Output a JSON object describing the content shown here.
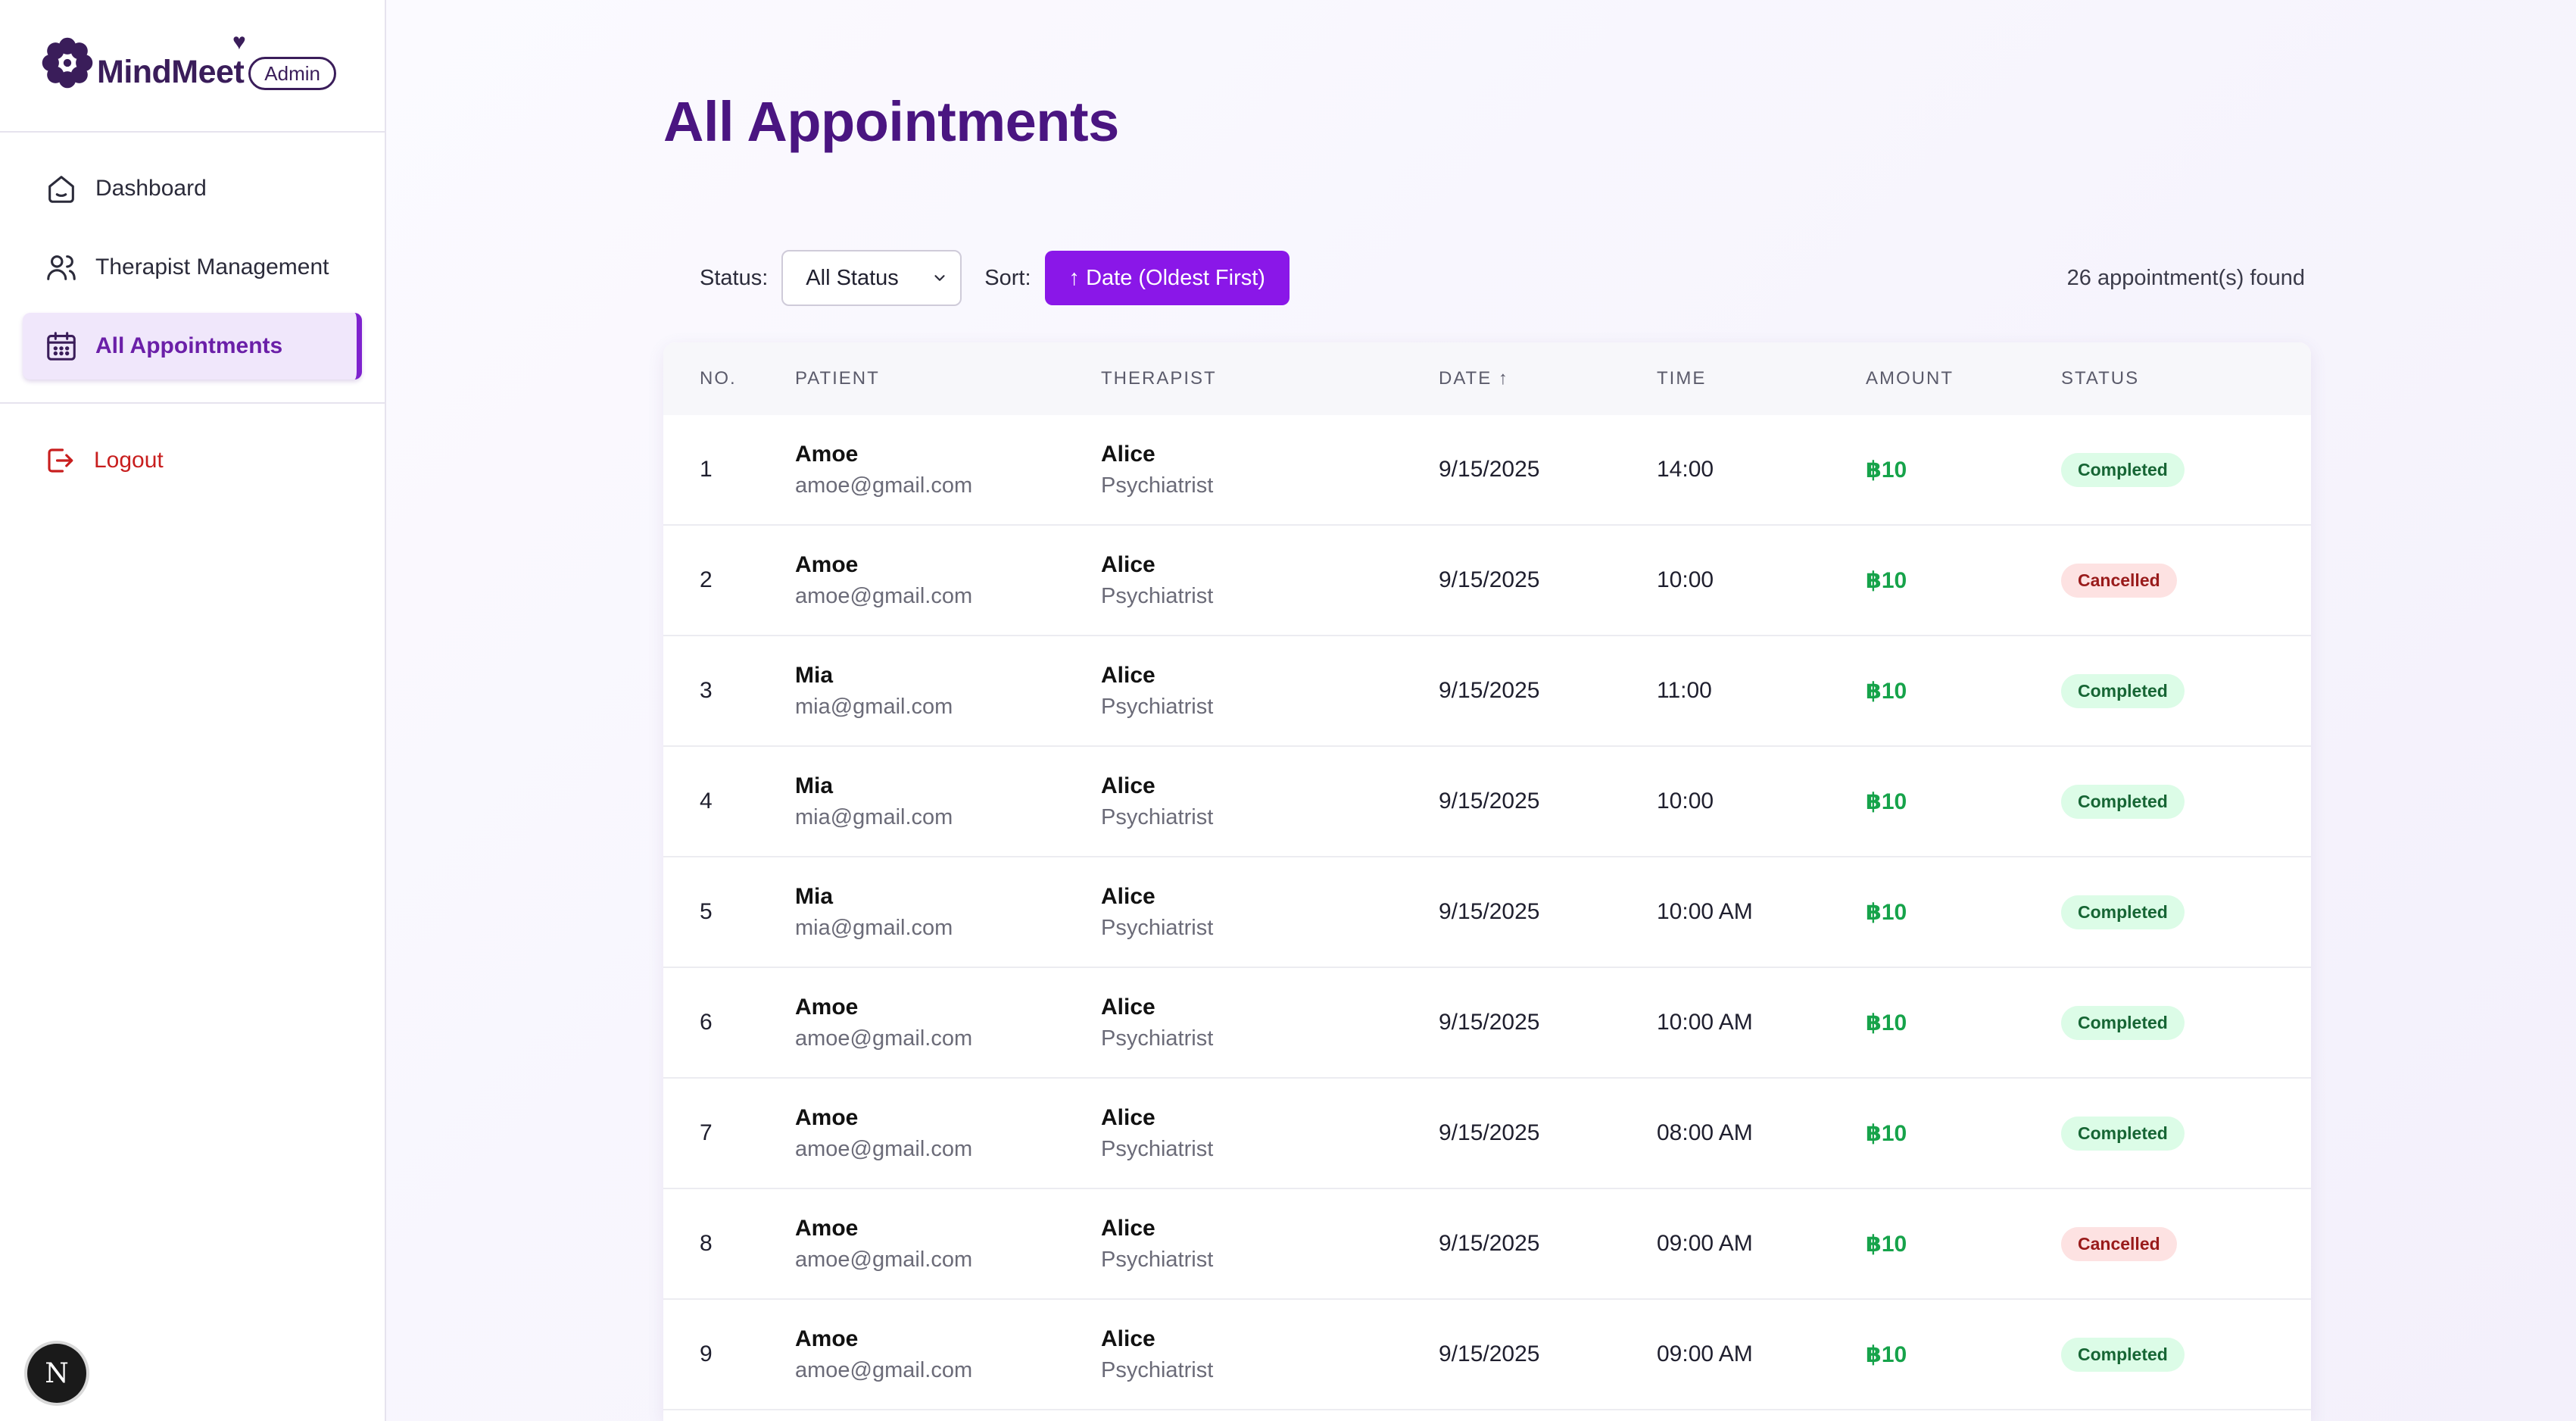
{
  "brand": {
    "name": "MindMeet",
    "badge": "Admin"
  },
  "sidebar": {
    "items": [
      {
        "label": "Dashboard",
        "icon": "home-icon"
      },
      {
        "label": "Therapist Management",
        "icon": "users-icon"
      },
      {
        "label": "All Appointments",
        "icon": "calendar-icon",
        "active": true
      }
    ],
    "logout_label": "Logout"
  },
  "page": {
    "title": "All Appointments"
  },
  "filters": {
    "status_label": "Status:",
    "status_value": "All Status",
    "sort_label": "Sort:",
    "sort_button": "↑ Date (Oldest First)",
    "count_text": "26 appointment(s) found"
  },
  "table": {
    "columns": [
      "NO.",
      "PATIENT",
      "THERAPIST",
      "DATE ↑",
      "TIME",
      "AMOUNT",
      "STATUS"
    ],
    "rows": [
      {
        "no": "1",
        "patient": "Amoe",
        "email": "amoe@gmail.com",
        "therapist": "Alice",
        "role": "Psychiatrist",
        "date": "9/15/2025",
        "time": "14:00",
        "amount": "฿10",
        "status": "Completed"
      },
      {
        "no": "2",
        "patient": "Amoe",
        "email": "amoe@gmail.com",
        "therapist": "Alice",
        "role": "Psychiatrist",
        "date": "9/15/2025",
        "time": "10:00",
        "amount": "฿10",
        "status": "Cancelled"
      },
      {
        "no": "3",
        "patient": "Mia",
        "email": "mia@gmail.com",
        "therapist": "Alice",
        "role": "Psychiatrist",
        "date": "9/15/2025",
        "time": "11:00",
        "amount": "฿10",
        "status": "Completed"
      },
      {
        "no": "4",
        "patient": "Mia",
        "email": "mia@gmail.com",
        "therapist": "Alice",
        "role": "Psychiatrist",
        "date": "9/15/2025",
        "time": "10:00",
        "amount": "฿10",
        "status": "Completed"
      },
      {
        "no": "5",
        "patient": "Mia",
        "email": "mia@gmail.com",
        "therapist": "Alice",
        "role": "Psychiatrist",
        "date": "9/15/2025",
        "time": "10:00 AM",
        "amount": "฿10",
        "status": "Completed"
      },
      {
        "no": "6",
        "patient": "Amoe",
        "email": "amoe@gmail.com",
        "therapist": "Alice",
        "role": "Psychiatrist",
        "date": "9/15/2025",
        "time": "10:00 AM",
        "amount": "฿10",
        "status": "Completed"
      },
      {
        "no": "7",
        "patient": "Amoe",
        "email": "amoe@gmail.com",
        "therapist": "Alice",
        "role": "Psychiatrist",
        "date": "9/15/2025",
        "time": "08:00 AM",
        "amount": "฿10",
        "status": "Completed"
      },
      {
        "no": "8",
        "patient": "Amoe",
        "email": "amoe@gmail.com",
        "therapist": "Alice",
        "role": "Psychiatrist",
        "date": "9/15/2025",
        "time": "09:00 AM",
        "amount": "฿10",
        "status": "Cancelled"
      },
      {
        "no": "9",
        "patient": "Amoe",
        "email": "amoe@gmail.com",
        "therapist": "Alice",
        "role": "Psychiatrist",
        "date": "9/15/2025",
        "time": "09:00 AM",
        "amount": "฿10",
        "status": "Completed"
      }
    ]
  },
  "dev_badge": {
    "letter": "N"
  },
  "colors": {
    "accent": "#8a17e8",
    "title": "#4a1581",
    "logout": "#c81e1e",
    "amount": "#16a34a"
  }
}
